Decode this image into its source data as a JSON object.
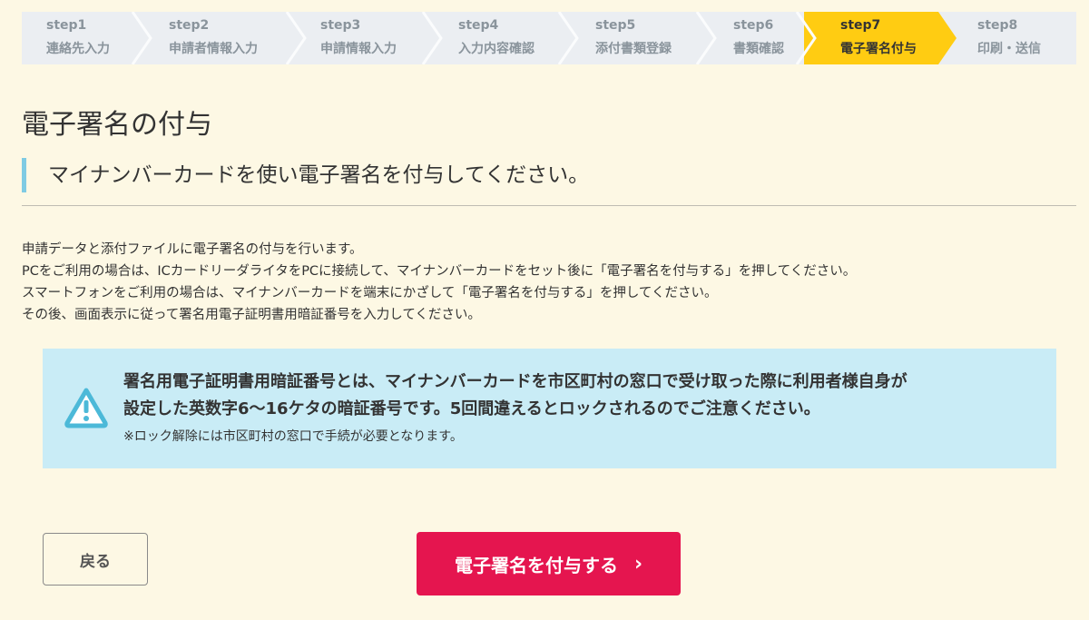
{
  "steps": [
    {
      "num": "step1",
      "label": "連絡先入力"
    },
    {
      "num": "step2",
      "label": "申請者情報入力"
    },
    {
      "num": "step3",
      "label": "申請情報入力"
    },
    {
      "num": "step4",
      "label": "入力内容確認"
    },
    {
      "num": "step5",
      "label": "添付書類登録"
    },
    {
      "num": "step6",
      "label": "書類確認"
    },
    {
      "num": "step7",
      "label": "電子署名付与"
    },
    {
      "num": "step8",
      "label": "印刷・送信"
    }
  ],
  "active_step": "step7",
  "colors": {
    "active_step": "#ffcc12",
    "notice_bg": "#c9ecf6",
    "accent_bar": "#7fcbe3",
    "primary_button": "#e5154f",
    "page_bg": "#fdf8e4"
  },
  "page": {
    "title": "電子署名の付与",
    "subtitle": "マイナンバーカードを使い電子署名を付与してください。"
  },
  "description": [
    "申請データと添付ファイルに電子署名の付与を行います。",
    "PCをご利用の場合は、ICカードリーダライタをPCに接続して、マイナンバーカードをセット後に「電子署名を付与する」を押してください。",
    "スマートフォンをご利用の場合は、マイナンバーカードを端末にかざして「電子署名を付与する」を押してください。",
    "その後、画面表示に従って署名用電子証明書用暗証番号を入力してください。"
  ],
  "notice": {
    "icon": "warning-icon",
    "line1": "署名用電子証明書用暗証番号とは、マイナンバーカードを市区町村の窓口で受け取った際に利用者様自身が",
    "line2": "設定した英数字6～16ケタの暗証番号です。5回間違えるとロックされるのでご注意ください。",
    "note": "※ロック解除には市区町村の窓口で手続が必要となります。"
  },
  "buttons": {
    "back": "戻る",
    "sign": "電子署名を付与する",
    "sign_arrow": "›"
  }
}
